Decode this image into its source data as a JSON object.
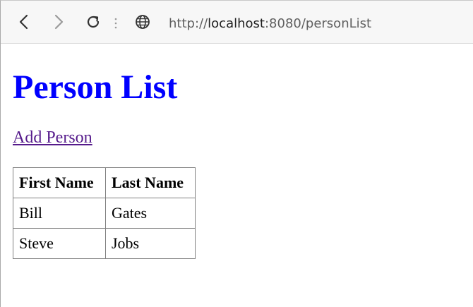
{
  "browser": {
    "back_icon": "chevron-left-icon",
    "forward_icon": "chevron-right-icon",
    "reload_icon": "reload-icon",
    "site_icon": "globe-icon",
    "url_scheme": "http://",
    "url_host": "localhost",
    "url_rest": ":8080/personList"
  },
  "page": {
    "title": "Person List",
    "add_link": "Add Person",
    "table": {
      "headers": [
        "First Name",
        "Last Name"
      ],
      "rows": [
        [
          "Bill",
          "Gates"
        ],
        [
          "Steve",
          "Jobs"
        ]
      ]
    }
  },
  "colors": {
    "title": "#0000ff",
    "link_visited": "#551a8b",
    "toolbar_bg": "#f7f7f7"
  }
}
